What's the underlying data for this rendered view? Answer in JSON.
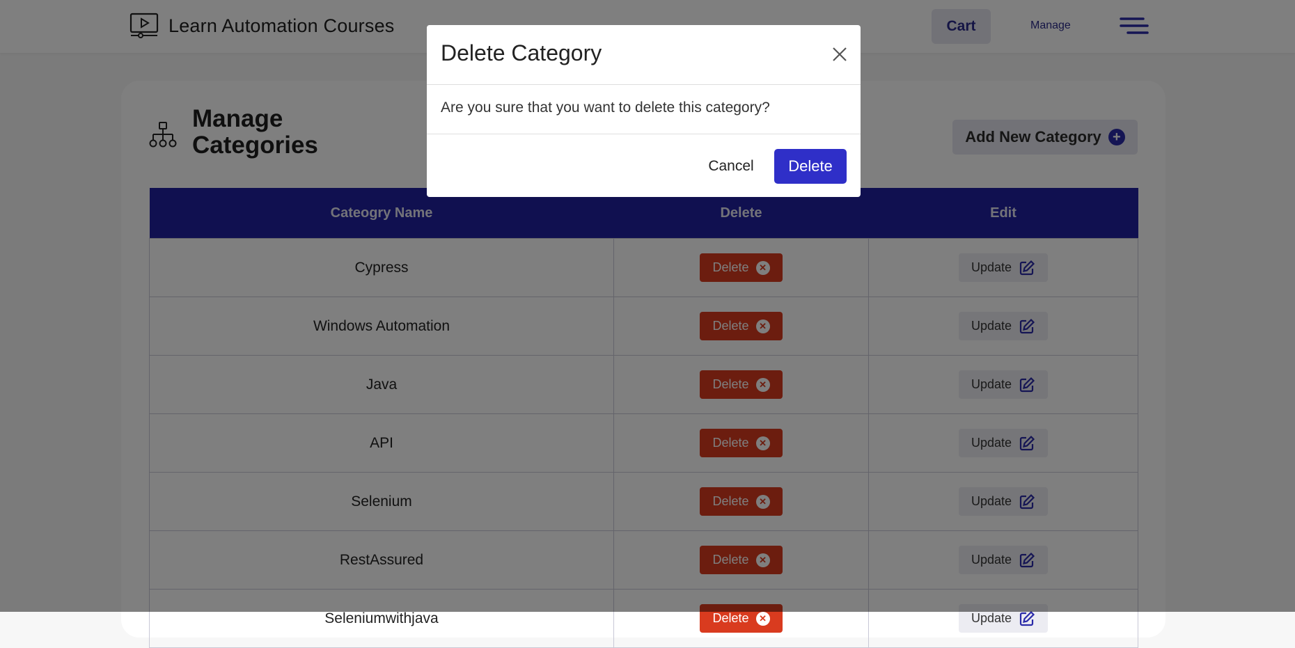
{
  "header": {
    "brand_title": "Learn Automation Courses",
    "cart_label": "Cart",
    "manage_label": "Manage"
  },
  "page": {
    "title": "Manage Categories",
    "add_button_label": "Add New Category"
  },
  "table": {
    "columns": [
      "Cateogry Name",
      "Delete",
      "Edit"
    ],
    "rows": [
      {
        "name": "Cypress",
        "delete_label": "Delete",
        "update_label": "Update"
      },
      {
        "name": "Windows Automation",
        "delete_label": "Delete",
        "update_label": "Update"
      },
      {
        "name": "Java",
        "delete_label": "Delete",
        "update_label": "Update"
      },
      {
        "name": "API",
        "delete_label": "Delete",
        "update_label": "Update"
      },
      {
        "name": "Selenium",
        "delete_label": "Delete",
        "update_label": "Update"
      },
      {
        "name": "RestAssured",
        "delete_label": "Delete",
        "update_label": "Update"
      },
      {
        "name": "Seleniumwithjava",
        "delete_label": "Delete",
        "update_label": "Update"
      }
    ]
  },
  "modal": {
    "title": "Delete Category",
    "message": "Are you sure that you want to delete this category?",
    "cancel_label": "Cancel",
    "confirm_label": "Delete"
  },
  "colors": {
    "accent": "#2020a0",
    "danger": "#d93b1f",
    "confirm": "#2f2fc8"
  },
  "icons": {
    "brand": "video-player-icon",
    "menu": "hamburger-menu-icon",
    "category": "hierarchy-icon",
    "add": "plus-circle-icon",
    "delete": "x-circle-icon",
    "update": "edit-icon",
    "close": "close-icon"
  }
}
